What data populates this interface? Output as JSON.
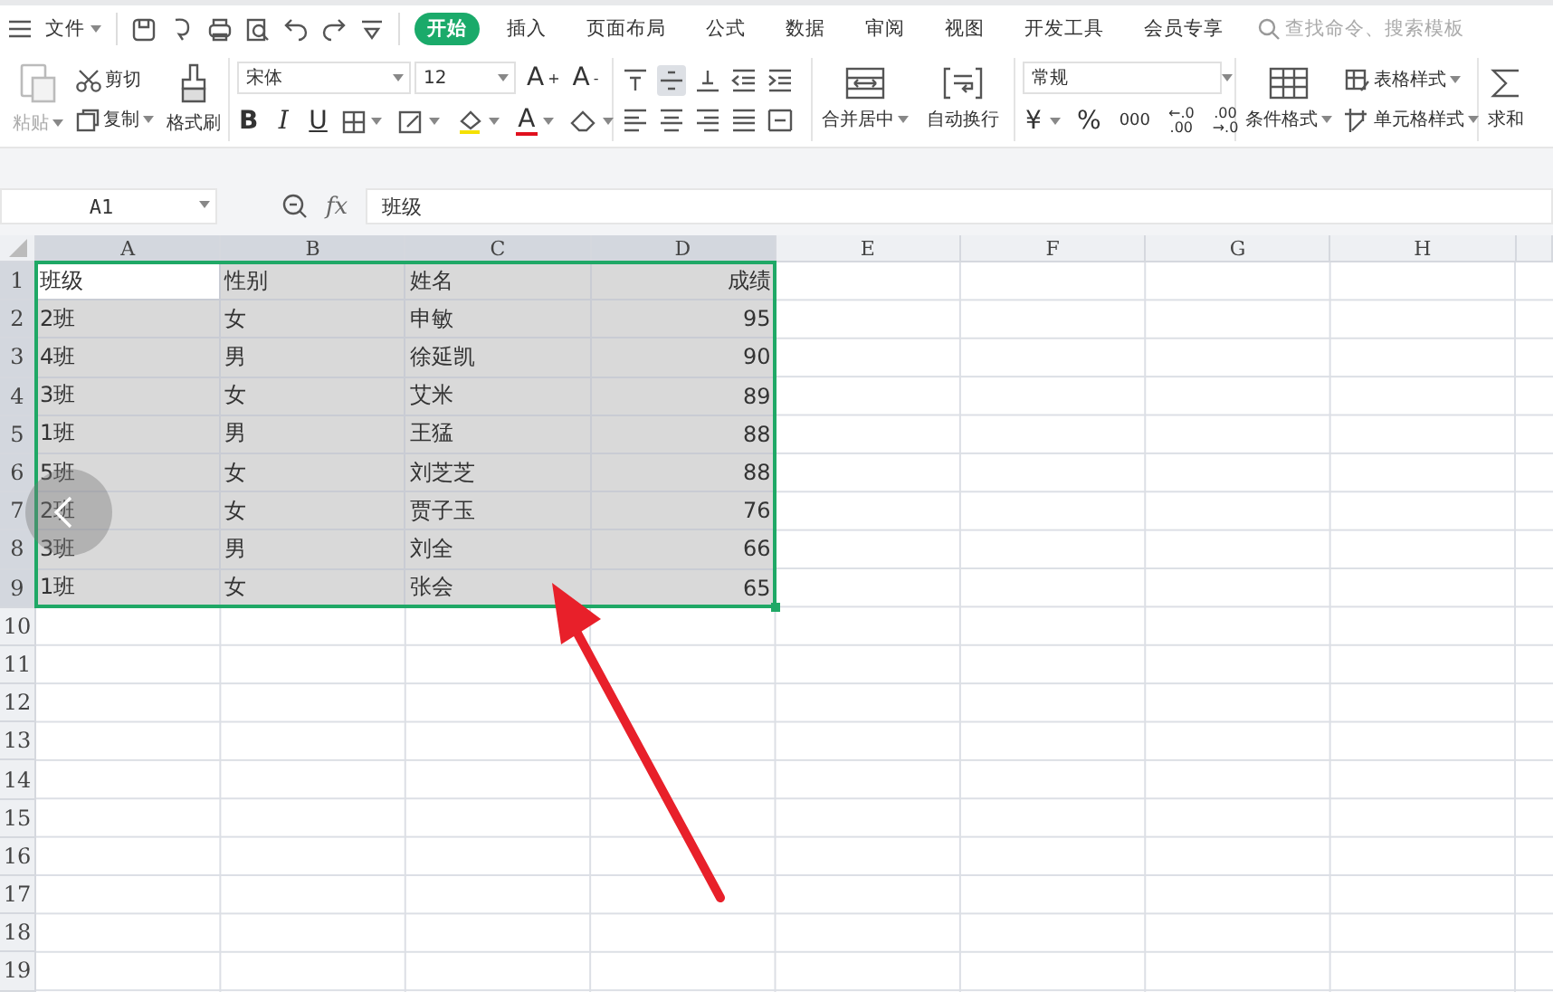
{
  "menubar": {
    "file_menu": "文件",
    "tabs": [
      {
        "label": "开始",
        "selected": true
      },
      {
        "label": "插入",
        "selected": false
      },
      {
        "label": "页面布局",
        "selected": false
      },
      {
        "label": "公式",
        "selected": false
      },
      {
        "label": "数据",
        "selected": false
      },
      {
        "label": "审阅",
        "selected": false
      },
      {
        "label": "视图",
        "selected": false
      },
      {
        "label": "开发工具",
        "selected": false
      },
      {
        "label": "会员专享",
        "selected": false
      }
    ],
    "search": {
      "placeholder": "查找命令、搜索模板"
    }
  },
  "ribbon": {
    "paste": {
      "label": "粘贴",
      "disabled": true
    },
    "cut": "剪切",
    "copy": "复制",
    "format_painter": "格式刷",
    "font": {
      "value": "宋体"
    },
    "font_size": {
      "value": "12"
    },
    "grow_font": "A$^{+}$",
    "shrink_font": "A$^{-}$",
    "text_styles": [
      {
        "kind": "bold",
        "label": "B"
      },
      {
        "kind": "italic",
        "label": "I"
      },
      {
        "kind": "underline",
        "label": "U"
      }
    ],
    "font_color": "A",
    "align_buttons": [
      {
        "selected": false
      },
      {
        "selected": true
      },
      {
        "selected": false
      },
      {
        "selected": false
      },
      {
        "selected": false
      },
      {
        "selected": false
      },
      {
        "selected": false
      },
      {
        "selected": false
      },
      {
        "selected": false
      },
      {
        "selected": false
      }
    ],
    "merge": "合并居中",
    "wrap": "自动换行",
    "number_format": {
      "value": "常规"
    },
    "number_buttons": [
      {
        "kind": "currency",
        "label": "¥"
      },
      {
        "kind": "percent",
        "label": "%"
      },
      {
        "kind": "thousands",
        "label": "000"
      },
      {
        "kind": "increase_decimal",
        "label": "←.0\n.00"
      },
      {
        "kind": "decrease_decimal",
        "label": ".00\n→.0"
      }
    ],
    "conditional_format": "条件格式",
    "table_style": "表格样式",
    "cell_style": "单元格样式",
    "sum": "求和"
  },
  "formula_bar": {
    "cell_ref": "A1",
    "fx": "fx",
    "formula": "班级"
  },
  "sheet": {
    "columns": [
      {
        "label": "A",
        "kind": "text",
        "selected": true
      },
      {
        "label": "B",
        "kind": "text",
        "selected": true
      },
      {
        "label": "C",
        "kind": "text",
        "selected": true
      },
      {
        "label": "D",
        "kind": "number",
        "selected": true
      },
      {
        "label": "E",
        "selected": false
      },
      {
        "label": "F",
        "selected": false
      },
      {
        "label": "G",
        "selected": false
      },
      {
        "label": "H",
        "selected": false
      }
    ],
    "rows": [
      {
        "number": "1",
        "selected": true,
        "cells": [
          {
            "text": "班级",
            "active": true
          },
          {
            "text": "性别",
            "active": false
          },
          {
            "text": "姓名",
            "active": false
          },
          {
            "text": "成绩",
            "active": false
          }
        ]
      },
      {
        "number": "2",
        "selected": true,
        "cells": [
          {
            "text": "2班",
            "active": false
          },
          {
            "text": "女",
            "active": false
          },
          {
            "text": "申敏",
            "active": false
          },
          {
            "text": "95",
            "active": false
          }
        ]
      },
      {
        "number": "3",
        "selected": true,
        "cells": [
          {
            "text": "4班",
            "active": false
          },
          {
            "text": "男",
            "active": false
          },
          {
            "text": "徐延凯",
            "active": false
          },
          {
            "text": "90",
            "active": false
          }
        ]
      },
      {
        "number": "4",
        "selected": true,
        "cells": [
          {
            "text": "3班",
            "active": false
          },
          {
            "text": "女",
            "active": false
          },
          {
            "text": "艾米",
            "active": false
          },
          {
            "text": "89",
            "active": false
          }
        ]
      },
      {
        "number": "5",
        "selected": true,
        "cells": [
          {
            "text": "1班",
            "active": false
          },
          {
            "text": "男",
            "active": false
          },
          {
            "text": "王猛",
            "active": false
          },
          {
            "text": "88",
            "active": false
          }
        ]
      },
      {
        "number": "6",
        "selected": true,
        "cells": [
          {
            "text": "5班",
            "active": false
          },
          {
            "text": "女",
            "active": false
          },
          {
            "text": "刘芝芝",
            "active": false
          },
          {
            "text": "88",
            "active": false
          }
        ]
      },
      {
        "number": "7",
        "selected": true,
        "cells": [
          {
            "text": "2班",
            "active": false
          },
          {
            "text": "女",
            "active": false
          },
          {
            "text": "贾子玉",
            "active": false
          },
          {
            "text": "76",
            "active": false
          }
        ]
      },
      {
        "number": "8",
        "selected": true,
        "cells": [
          {
            "text": "3班",
            "active": false
          },
          {
            "text": "男",
            "active": false
          },
          {
            "text": "刘全",
            "active": false
          },
          {
            "text": "66",
            "active": false
          }
        ]
      },
      {
        "number": "9",
        "selected": true,
        "cells": [
          {
            "text": "1班",
            "active": false
          },
          {
            "text": "女",
            "active": false
          },
          {
            "text": "张会",
            "active": false
          },
          {
            "text": "65",
            "active": false
          }
        ]
      },
      {
        "number": "10",
        "selected": false,
        "cells": []
      },
      {
        "number": "11",
        "selected": false,
        "cells": []
      },
      {
        "number": "12",
        "selected": false,
        "cells": []
      },
      {
        "number": "13",
        "selected": false,
        "cells": []
      },
      {
        "number": "14",
        "selected": false,
        "cells": []
      },
      {
        "number": "15",
        "selected": false,
        "cells": []
      },
      {
        "number": "16",
        "selected": false,
        "cells": []
      },
      {
        "number": "17",
        "selected": false,
        "cells": []
      },
      {
        "number": "18",
        "selected": false,
        "cells": []
      },
      {
        "number": "19",
        "selected": false,
        "cells": []
      }
    ]
  }
}
